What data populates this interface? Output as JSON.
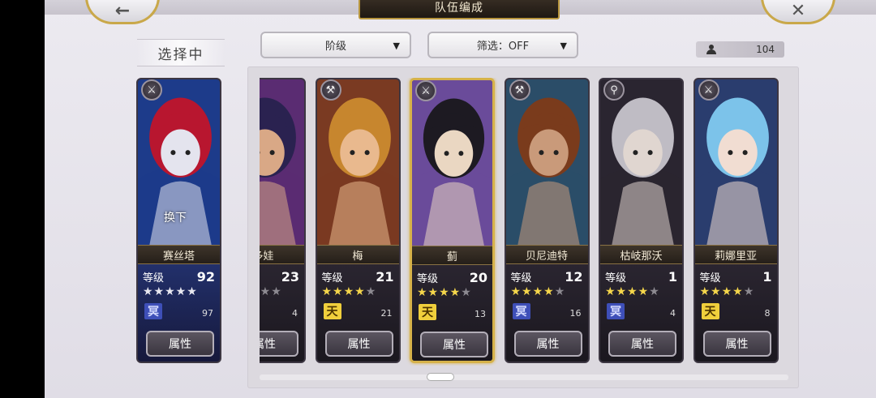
{
  "header": {
    "title": "队伍编成",
    "back_icon": "←",
    "close_icon": "✕"
  },
  "selecting_label": "选择中",
  "filters": {
    "rank_label": "阶级",
    "filter_label": "筛选：OFF",
    "arrow": "▼"
  },
  "unit_count": "104",
  "current": {
    "name": "赛丝塔",
    "level_label": "等级",
    "level": "92",
    "stars_on": 5,
    "class": "earth",
    "class_glyph": "冥",
    "sub": "97",
    "swap_label": "换下",
    "attr_label": "属性",
    "weapon_glyph": "⚔",
    "colors": [
      "#b8162f",
      "#e4e4ee",
      "#1d3b8a"
    ]
  },
  "cards": [
    {
      "name": "多娃",
      "level_label": "级",
      "level": "23",
      "stars_on": 3,
      "class": "heaven",
      "class_glyph": "",
      "sub": "4",
      "attr_label": "属性",
      "weapon_glyph": "",
      "colors": [
        "#2a2250",
        "#d9a886",
        "#5a2c72"
      ]
    },
    {
      "name": "梅",
      "level_label": "等级",
      "level": "21",
      "stars_on": 4,
      "class": "heaven",
      "class_glyph": "天",
      "sub": "21",
      "attr_label": "属性",
      "weapon_glyph": "⚒",
      "colors": [
        "#c7862e",
        "#e9b98e",
        "#7a3a22"
      ]
    },
    {
      "name": "蓟",
      "level_label": "等级",
      "level": "20",
      "stars_on": 4,
      "class": "heaven",
      "class_glyph": "天",
      "sub": "13",
      "attr_label": "属性",
      "weapon_glyph": "⚔",
      "colors": [
        "#1d1a22",
        "#ead7c2",
        "#6a4b9a"
      ],
      "selected": true
    },
    {
      "name": "贝尼迪特",
      "level_label": "等级",
      "level": "12",
      "stars_on": 4,
      "class": "earth",
      "class_glyph": "冥",
      "sub": "16",
      "attr_label": "属性",
      "weapon_glyph": "⚒",
      "colors": [
        "#7a3b1c",
        "#c99a7a",
        "#2b4d68"
      ]
    },
    {
      "name": "枯岐那沃",
      "level_label": "等级",
      "level": "1",
      "stars_on": 4,
      "class": "earth",
      "class_glyph": "冥",
      "sub": "4",
      "attr_label": "属性",
      "weapon_glyph": "⚲",
      "colors": [
        "#bfbcc4",
        "#e0d6d0",
        "#2a2530"
      ]
    },
    {
      "name": "莉娜里亚",
      "level_label": "等级",
      "level": "1",
      "stars_on": 4,
      "class": "heaven",
      "class_glyph": "天",
      "sub": "8",
      "attr_label": "属性",
      "weapon_glyph": "⚔",
      "colors": [
        "#7cc3ea",
        "#f1ddd2",
        "#2a3d6e"
      ]
    }
  ]
}
